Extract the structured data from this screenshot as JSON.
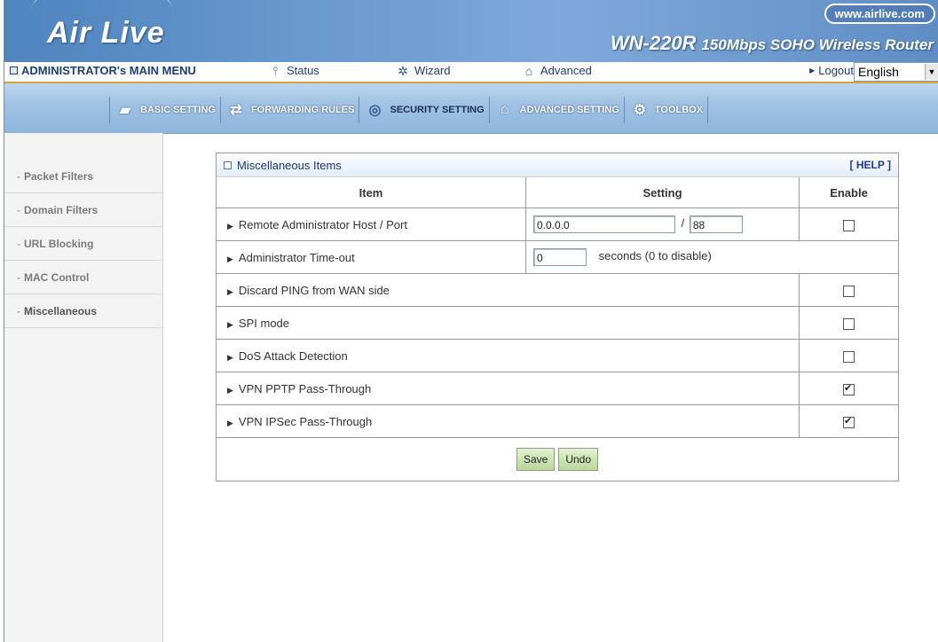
{
  "header": {
    "logo_text": "Air Live",
    "site_url": "www.airlive.com",
    "model": "WN-220R",
    "model_desc": "150Mbps SOHO Wireless Router"
  },
  "menu": {
    "admin_label": "ADMINISTRATOR's MAIN MENU",
    "status": "Status",
    "wizard": "Wizard",
    "advanced": "Advanced",
    "logout": "Logout",
    "language": "English"
  },
  "tabs": [
    {
      "label": "BASIC SETTING",
      "icon": "folder-icon"
    },
    {
      "label": "FORWARDING RULES",
      "icon": "arrows-icon"
    },
    {
      "label": "SECURITY SETTING",
      "icon": "lock-icon"
    },
    {
      "label": "ADVANCED SETTING",
      "icon": "house-icon"
    },
    {
      "label": "TOOLBOX",
      "icon": "toolbox-icon"
    }
  ],
  "sidebar": {
    "items": [
      {
        "label": "Packet Filters"
      },
      {
        "label": "Domain Filters"
      },
      {
        "label": "URL Blocking"
      },
      {
        "label": "MAC Control"
      },
      {
        "label": "Miscellaneous"
      }
    ]
  },
  "panel": {
    "title": "Miscellaneous Items",
    "help": "[ HELP ]",
    "headers": {
      "item": "Item",
      "setting": "Setting",
      "enable": "Enable"
    },
    "rows": [
      {
        "label": "Remote Administrator Host / Port",
        "host": "0.0.0.0",
        "separator": "/",
        "port": "88",
        "enabled": false
      },
      {
        "label": "Administrator Time-out",
        "timeout": "0",
        "timeout_note": "seconds (0 to disable)"
      },
      {
        "label": "Discard PING from WAN side",
        "enabled": false
      },
      {
        "label": "SPI mode",
        "enabled": false
      },
      {
        "label": "DoS Attack Detection",
        "enabled": false
      },
      {
        "label": "VPN PPTP Pass-Through",
        "enabled": true
      },
      {
        "label": "VPN IPSec Pass-Through",
        "enabled": true
      }
    ],
    "save": "Save",
    "undo": "Undo"
  }
}
